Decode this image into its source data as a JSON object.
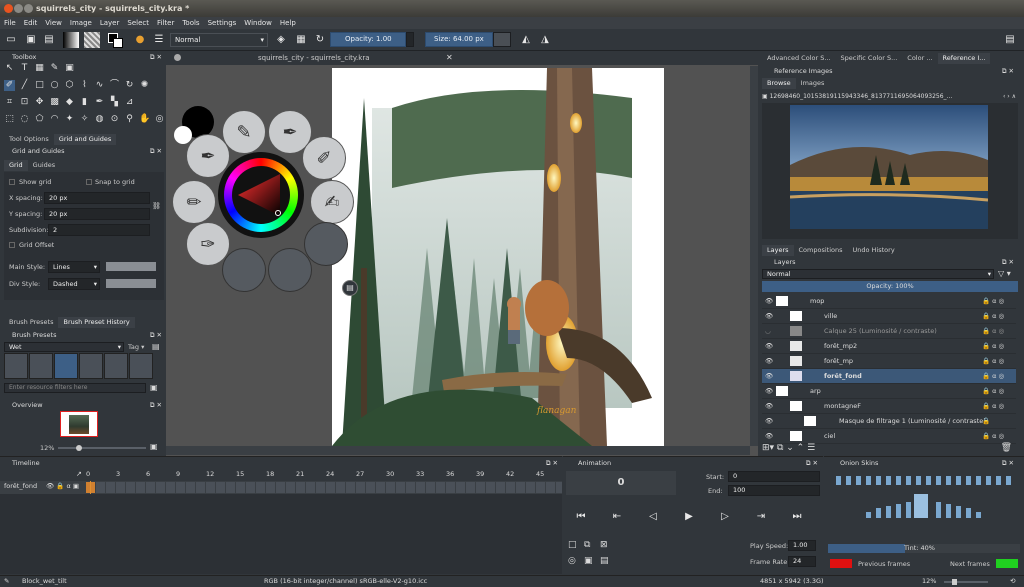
{
  "window": {
    "title": "squirrels_city - squirrels_city.kra *"
  },
  "menu": [
    "File",
    "Edit",
    "View",
    "Image",
    "Layer",
    "Select",
    "Filter",
    "Tools",
    "Settings",
    "Window",
    "Help"
  ],
  "toolbar": {
    "blend_mode": "Normal",
    "opacity_label": "Opacity:",
    "opacity_value": "1.00",
    "size_label": "Size:",
    "size_value": "64.00 px"
  },
  "toolbox": {
    "title": "Toolbox"
  },
  "tool_tabs": [
    "Tool Options",
    "Grid and Guides"
  ],
  "grid_panel": {
    "title": "Grid and Guides",
    "tabs": [
      "Grid",
      "Guides"
    ],
    "show_grid": "Show grid",
    "snap_to_grid": "Snap to grid",
    "x_spacing_label": "X spacing:",
    "x_spacing": "20 px",
    "y_spacing_label": "Y spacing:",
    "y_spacing": "20 px",
    "subdivision_label": "Subdivision:",
    "subdivision": "2",
    "grid_offset": "Grid Offset",
    "main_style_label": "Main Style:",
    "main_style": "Lines",
    "div_style_label": "Div Style:",
    "div_style": "Dashed"
  },
  "brush_tabs": [
    "Brush Presets",
    "Brush Preset History"
  ],
  "brush_presets": {
    "title": "Brush Presets",
    "tag_filter": "Wet",
    "tag_label": "Tag",
    "filter_placeholder": "Enter resource filters here"
  },
  "overview": {
    "title": "Overview",
    "zoom": "12%"
  },
  "canvas": {
    "tab_title": "squirrels_city - squirrels_city.kra",
    "signature": "flanagan"
  },
  "reference": {
    "tabs": [
      "Advanced Color S...",
      "Specific Color S...",
      "Color ...",
      "Reference I..."
    ],
    "title": "Reference Images",
    "subtabs": [
      "Browse",
      "Images"
    ],
    "path": "12698460_10153819115943346_8137711695064093256_..."
  },
  "layers_tabs": [
    "Layers",
    "Compositions",
    "Undo History"
  ],
  "layers": {
    "title": "Layers",
    "blend": "Normal",
    "opacity": "Opacity:  100%",
    "items": [
      {
        "name": "mop"
      },
      {
        "name": "ville"
      },
      {
        "name": "Calque 25 (Luminosité / contraste)"
      },
      {
        "name": "forêt_mp2"
      },
      {
        "name": "forêt_mp"
      },
      {
        "name": "forêt_fond",
        "selected": true
      },
      {
        "name": "arp"
      },
      {
        "name": "montagneF"
      },
      {
        "name": "Masque de filtrage 1 (Luminosité / contraste)"
      },
      {
        "name": "ciel"
      }
    ]
  },
  "timeline": {
    "title": "Timeline",
    "layer": "forêt_fond",
    "frames": [
      "0",
      "3",
      "6",
      "9",
      "12",
      "15",
      "18",
      "21",
      "24",
      "27",
      "30",
      "33",
      "36",
      "39",
      "42",
      "45"
    ]
  },
  "animation": {
    "title": "Animation",
    "current_frame": "0",
    "start_label": "Start:",
    "start": "0",
    "end_label": "End:",
    "end": "100",
    "play_speed_label": "Play Speed:",
    "play_speed": "1.00",
    "frame_rate_label": "Frame Rate:",
    "frame_rate": "24"
  },
  "onion": {
    "title": "Onion Skins",
    "tint": "Tint: 40%",
    "previous": "Previous frames",
    "next": "Next frames"
  },
  "statusbar": {
    "brush": "Block_wet_tilt",
    "color": "RGB (16-bit integer/channel)  sRGB-elle-V2-g10.icc",
    "size": "4851 x 5942 (3.3G)",
    "zoom": "12%"
  },
  "colors": {
    "accent": "#3d5f86",
    "prev_frames": "#e01010",
    "next_frames": "#20d020"
  }
}
